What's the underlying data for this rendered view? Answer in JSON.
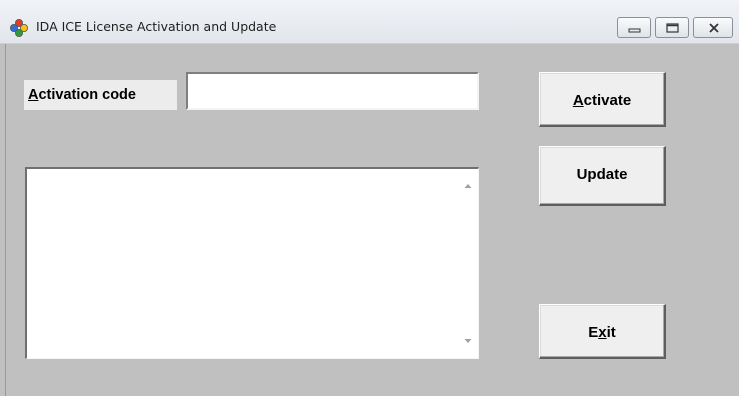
{
  "window": {
    "title": "IDA ICE License Activation and Update",
    "controls": [
      "minimize",
      "maximize",
      "close"
    ]
  },
  "form": {
    "activation_label_first": "A",
    "activation_label_rest": "ctivation code",
    "activation_value": "",
    "log_text": ""
  },
  "buttons": {
    "activate_first": "A",
    "activate_rest": "ctivate",
    "update": "Update",
    "exit_pre": "E",
    "exit_mnemonic": "x",
    "exit_post": "it"
  }
}
